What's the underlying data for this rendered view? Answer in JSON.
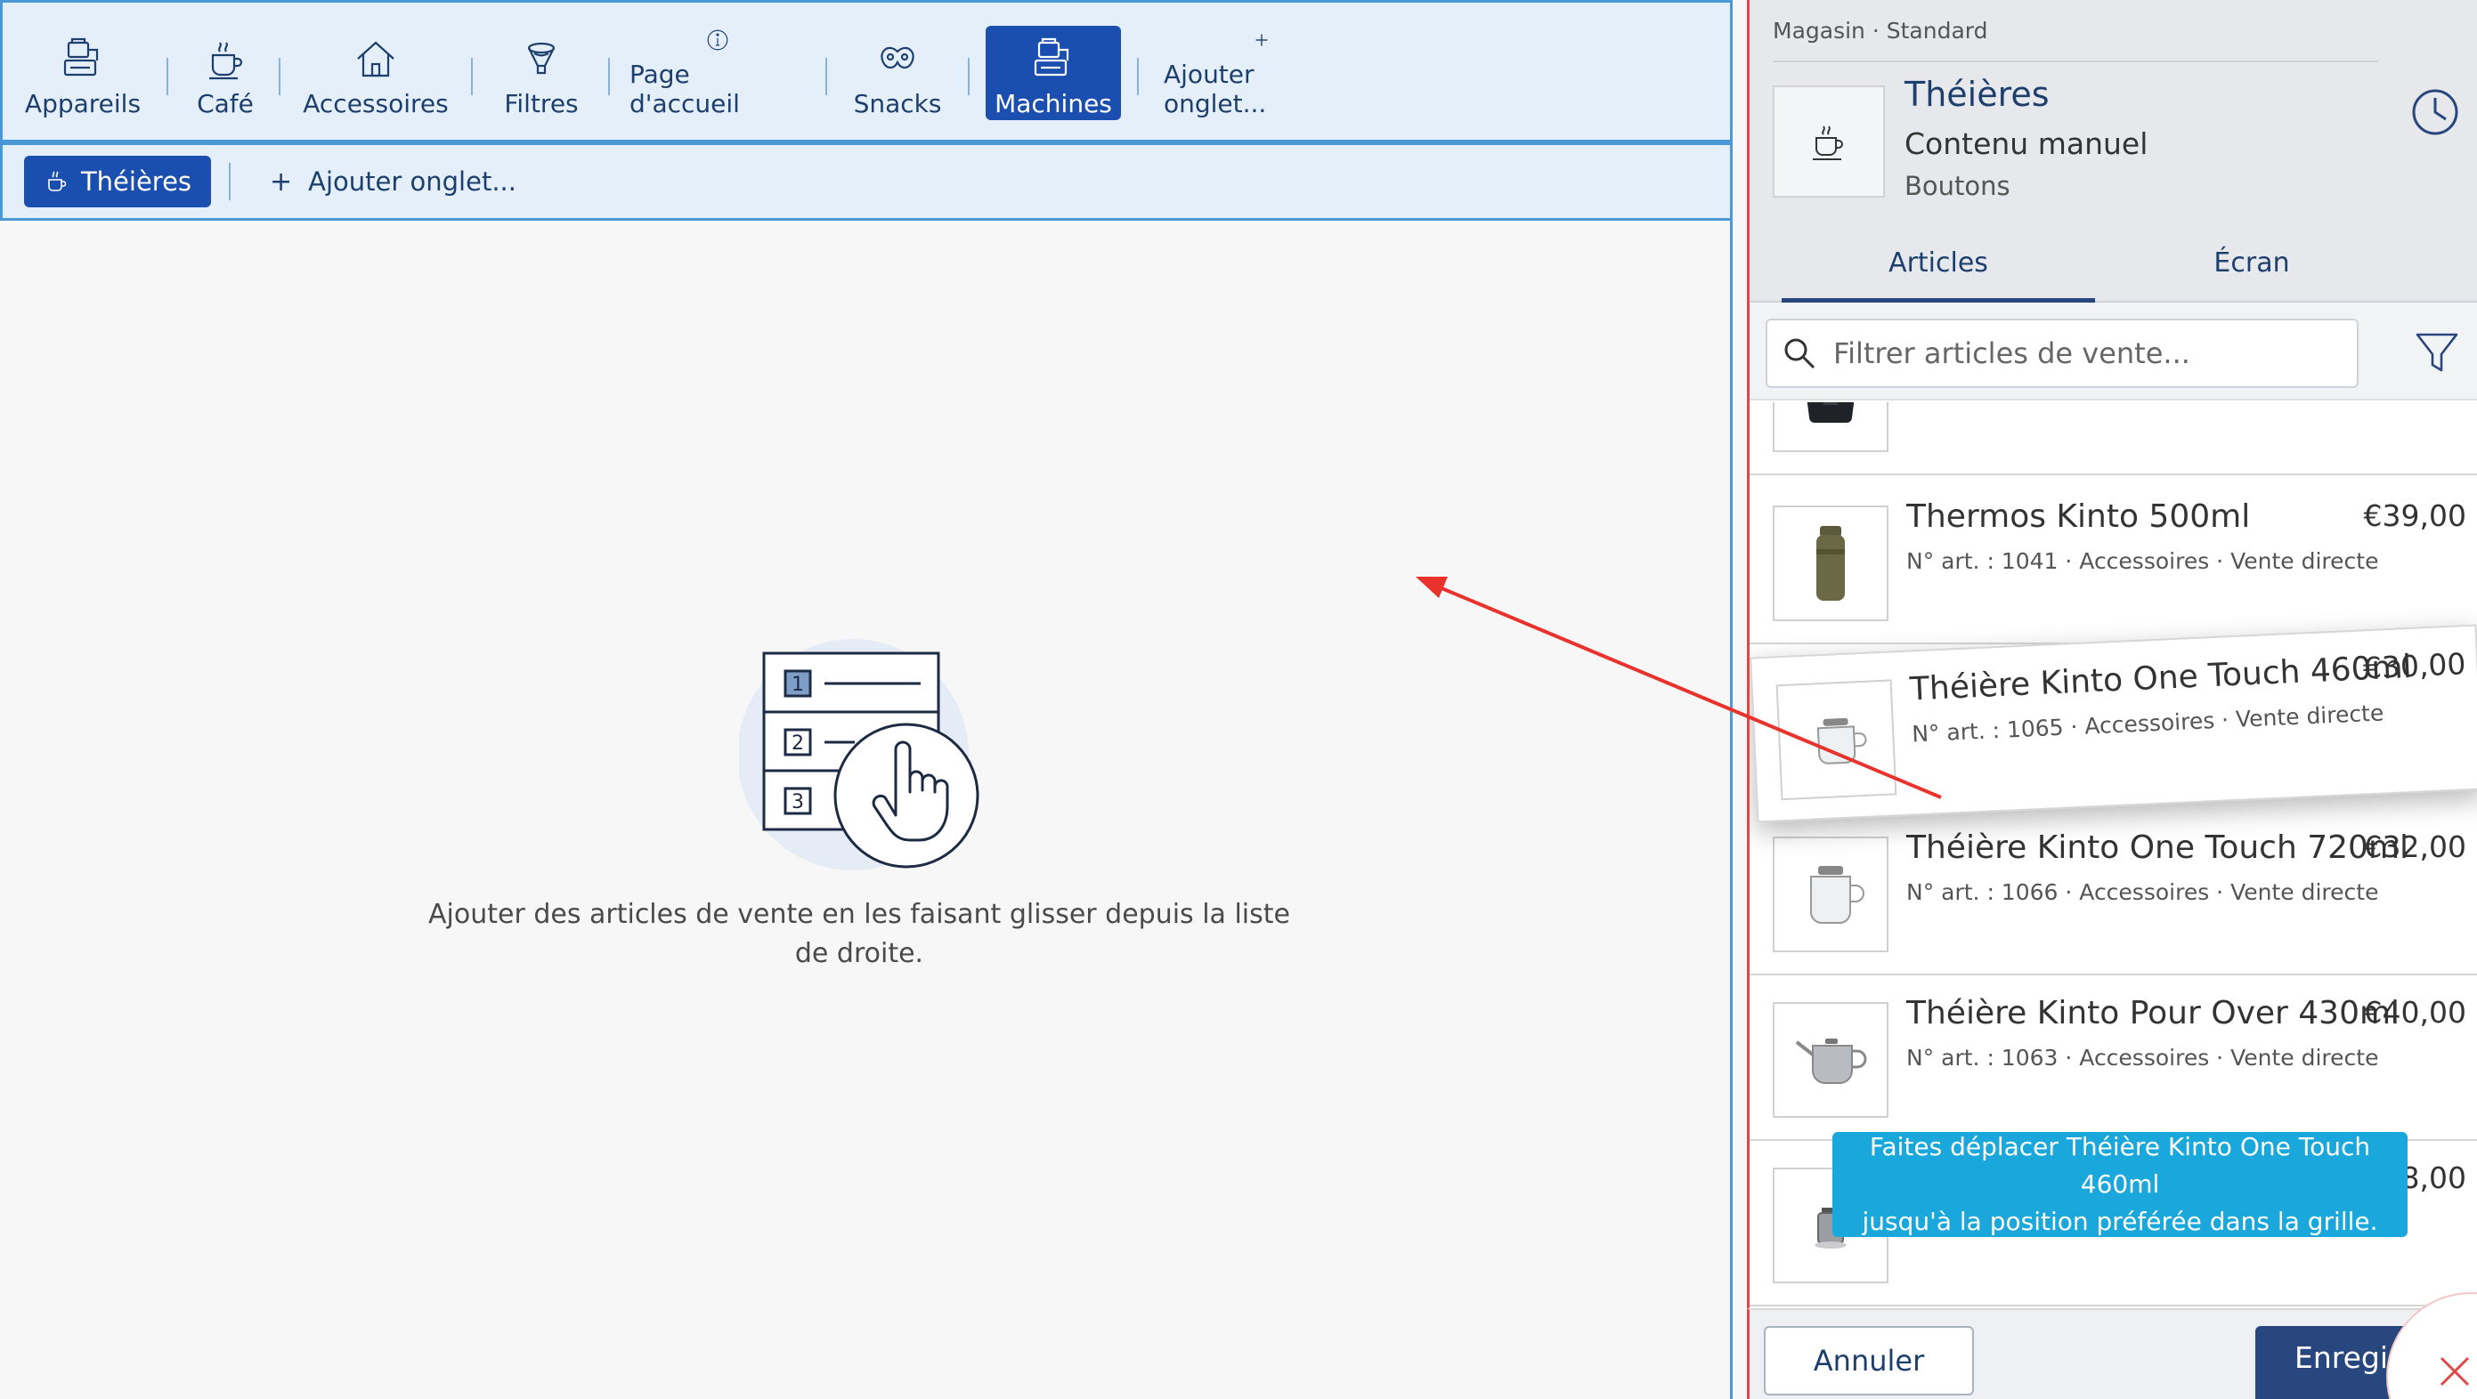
{
  "category_tabs": [
    {
      "label": "Appareils",
      "icon": "devices-icon",
      "active": false
    },
    {
      "label": "Café",
      "icon": "coffee-cup-icon",
      "active": false
    },
    {
      "label": "Accessoires",
      "icon": "house-icon",
      "active": false
    },
    {
      "label": "Filtres",
      "icon": "filter-funnel-icon",
      "active": false
    },
    {
      "label": "Page d'accueil",
      "icon": "info-icon",
      "active": false
    },
    {
      "label": "Snacks",
      "icon": "pretzel-icon",
      "active": false
    },
    {
      "label": "Machines",
      "icon": "machine-icon",
      "active": true
    },
    {
      "label": "Ajouter onglet...",
      "icon": "plus-icon",
      "active": false
    }
  ],
  "sub_tabs": {
    "active_label": "Théières",
    "add_label": "Ajouter onglet..."
  },
  "empty_state": {
    "text": "Ajouter des articles de vente en les faisant glisser depuis la liste de droite.",
    "illustration": "numbered-list-drag-hand-icon"
  },
  "panel": {
    "breadcrumb": "Magasin · Standard",
    "title": "Théières",
    "subtitle": "Contenu manuel",
    "type": "Boutons",
    "tabs": [
      "Articles",
      "Écran"
    ],
    "active_tab": "Articles",
    "search_placeholder": "Filtrer articles de vente..."
  },
  "items": [
    {
      "name": "",
      "meta": "",
      "price": "",
      "image": "black-kettle-icon"
    },
    {
      "name": "Thermos Kinto 500ml",
      "meta": "N° art. : 1041 · Accessoires · Vente directe",
      "price": "€39,00",
      "image": "thermos-icon"
    },
    {
      "name": "Théière Kinto One Touch 460ml",
      "meta": "N° art. : 1065 · Accessoires · Vente directe",
      "price": "€30,00",
      "image": "teapot-glass-icon",
      "dragging": true
    },
    {
      "name": "Théière Kinto One Touch 720ml",
      "meta": "N° art. : 1066 · Accessoires · Vente directe",
      "price": "€32,00",
      "image": "teapot-glass-icon"
    },
    {
      "name": "Théière Kinto Pour Over 430ml",
      "meta": "N° art. : 1063 · Accessoires · Vente directe",
      "price": "€40,00",
      "image": "pour-over-kettle-icon"
    },
    {
      "name": "",
      "meta": "",
      "price": "8,00",
      "image": "tea-infuser-icon"
    }
  ],
  "tooltip": {
    "line1": "Faites déplacer Théière Kinto One Touch 460ml",
    "line2": "jusqu'à la position préférée dans la grille."
  },
  "footer": {
    "cancel_label": "Annuler",
    "save_label": "Enregis"
  },
  "colors": {
    "accent": "#1a4fb0",
    "panel_border": "#e04848",
    "tooltip": "#1aa8dc",
    "drag_arrow": "#e8322b"
  }
}
